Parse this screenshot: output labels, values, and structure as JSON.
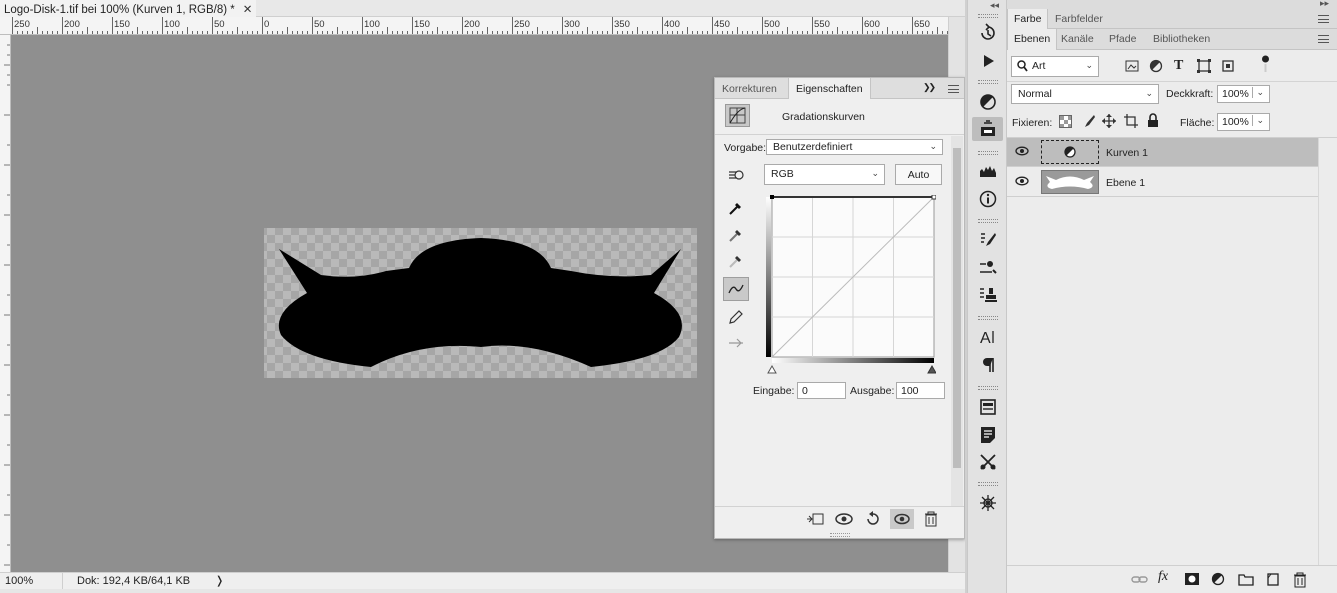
{
  "document": {
    "tab_title": "Logo-Disk-1.tif bei 100% (Kurven 1, RGB/8) *",
    "close_glyph": "✕",
    "ruler_labels": [
      "250",
      "200",
      "150",
      "100",
      "50",
      "0",
      "50",
      "100",
      "150",
      "200",
      "250",
      "300",
      "350",
      "400",
      "450",
      "500",
      "550",
      "600",
      "650"
    ],
    "status_zoom": "100%",
    "status_doc": "Dok: 192,4 KB/64,1 KB",
    "status_arrow": "❭"
  },
  "properties_panel": {
    "tabs": [
      "Korrekturen",
      "Eigenschaften"
    ],
    "active_tab": "Eigenschaften",
    "expand_glyph": "❯❯",
    "title": "Gradationskurven",
    "preset_label": "Vorgabe:",
    "preset_value": "Benutzerdefiniert",
    "channel_value": "RGB",
    "auto_label": "Auto",
    "input_label": "Eingabe:",
    "input_value": "0",
    "output_label": "Ausgabe:",
    "output_value": "100"
  },
  "color_panel": {
    "tabs": [
      "Farbe",
      "Farbfelder"
    ]
  },
  "layers_panel": {
    "tabs": [
      "Ebenen",
      "Kanäle",
      "Pfade",
      "Bibliotheken"
    ],
    "filter_value": "Art",
    "blend_mode": "Normal",
    "opacity_label": "Deckkraft:",
    "opacity_value": "100%",
    "lock_label": "Fixieren:",
    "fill_label": "Fläche:",
    "fill_value": "100%",
    "layers": [
      {
        "name": "Kurven 1",
        "selected": true
      },
      {
        "name": "Ebene 1",
        "selected": false
      }
    ],
    "fx_label": "fx"
  },
  "colors": {
    "canvas_bg": "#8f8f8f",
    "shape": "#000000",
    "selected_layer": "#bdbdbd"
  }
}
